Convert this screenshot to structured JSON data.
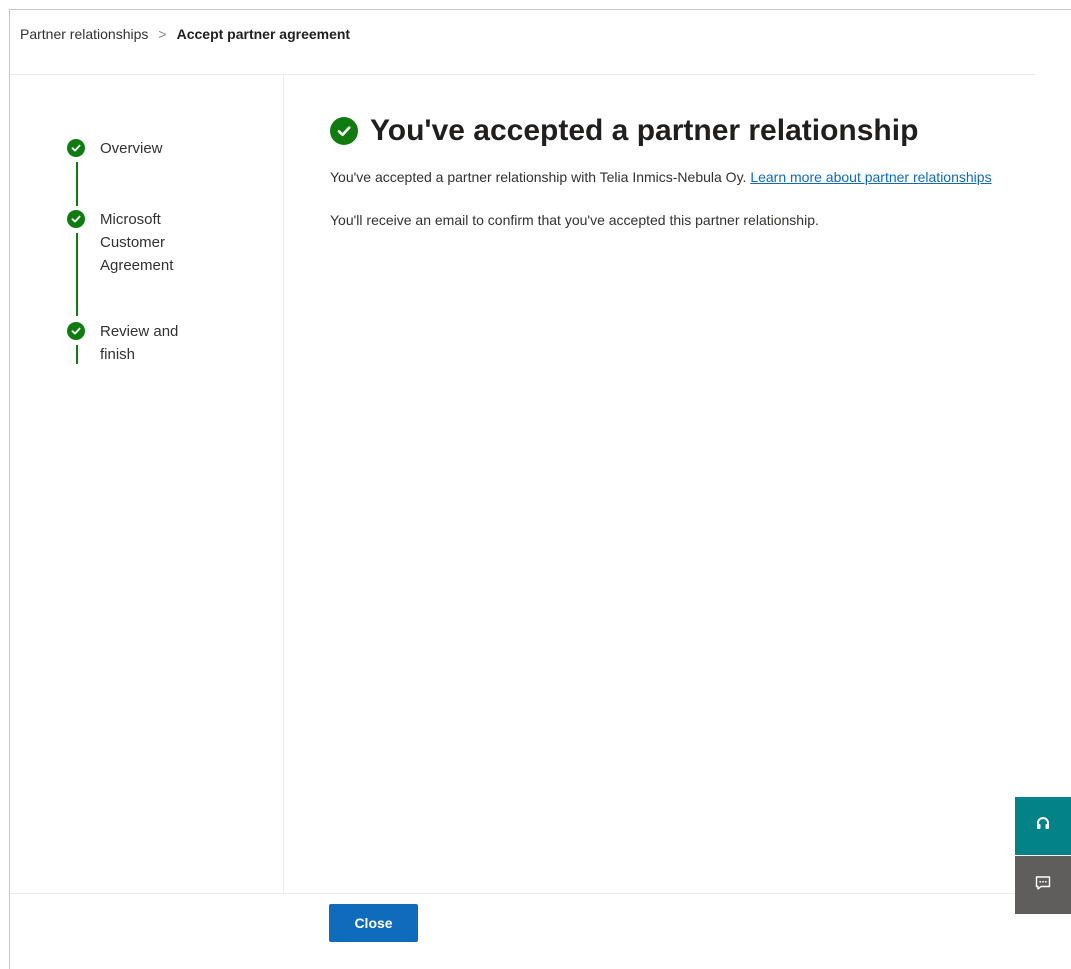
{
  "breadcrumb": {
    "parent": "Partner relationships",
    "separator": ">",
    "current": "Accept partner agreement"
  },
  "steps": [
    {
      "label": "Overview",
      "status": "complete"
    },
    {
      "label": "Microsoft Customer Agreement",
      "status": "complete"
    },
    {
      "label": "Review and finish",
      "status": "complete"
    }
  ],
  "main": {
    "title": "You've accepted a partner relationship",
    "paragraph1_text": "You've accepted a partner relationship with Telia Inmics-Nebula Oy. ",
    "paragraph1_link": "Learn more about partner relationships",
    "paragraph2": "You'll receive an email to confirm that you've accepted this partner relationship."
  },
  "footer": {
    "close_label": "Close"
  },
  "side_buttons": [
    {
      "icon": "headset-icon"
    },
    {
      "icon": "feedback-icon"
    }
  ],
  "colors": {
    "success": "#107c10",
    "primary": "#0f6cbd",
    "help": "#038387",
    "feedback": "#605e5c"
  }
}
